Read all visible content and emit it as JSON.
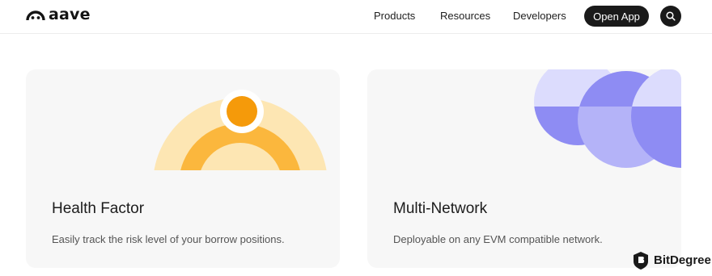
{
  "header": {
    "brand": "aave",
    "nav": [
      "Products",
      "Resources",
      "Developers"
    ],
    "open_app": "Open App"
  },
  "cards": [
    {
      "title": "Health Factor",
      "description": "Easily track the risk level of your borrow positions."
    },
    {
      "title": "Multi-Network",
      "description": "Deployable on any EVM compatible network."
    }
  ],
  "watermark": "BitDegree",
  "colors": {
    "dark": "#1a1a1a",
    "card_bg": "#f7f7f7",
    "orange": "#f59a0a",
    "amber": "#fbb73d",
    "light_amber": "#fde6b3",
    "violet": "#8e8cf3",
    "lavender": "#b4b3f8",
    "pale_lavender": "#dcdcfd"
  },
  "icons": [
    "ghost-logo-icon",
    "search-icon",
    "bitdegree-shield-icon"
  ]
}
